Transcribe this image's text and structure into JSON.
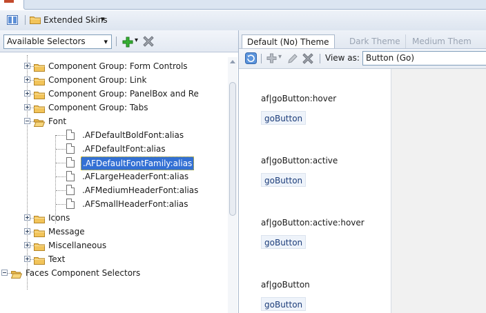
{
  "window": {
    "top_strip": ""
  },
  "main_toolbar": {
    "skin_menu_label": "Extended Skins",
    "skin_menu_arrow": "▾"
  },
  "left_panel": {
    "selector_dropdown_label": "Available Selectors",
    "selector_dropdown_arrow": "▾",
    "tree": [
      {
        "label": "Component Group: Form Controls",
        "type": "folder",
        "expanded": false
      },
      {
        "label": "Component Group: Link",
        "type": "folder",
        "expanded": false
      },
      {
        "label": "Component Group: PanelBox and Re",
        "type": "folder",
        "expanded": false
      },
      {
        "label": "Component Group: Tabs",
        "type": "folder",
        "expanded": false
      },
      {
        "label": "Font",
        "type": "folder",
        "expanded": true
      },
      {
        "label": ".AFDefaultBoldFont:alias",
        "type": "item"
      },
      {
        "label": ".AFDefaultFont:alias",
        "type": "item"
      },
      {
        "label": ".AFDefaultFontFamily:alias",
        "type": "item",
        "selected": true
      },
      {
        "label": ".AFLargeHeaderFont:alias",
        "type": "item"
      },
      {
        "label": ".AFMediumHeaderFont:alias",
        "type": "item"
      },
      {
        "label": ".AFSmallHeaderFont:alias",
        "type": "item"
      },
      {
        "label": "Icons",
        "type": "folder",
        "expanded": false
      },
      {
        "label": "Message",
        "type": "folder",
        "expanded": false
      },
      {
        "label": "Miscellaneous",
        "type": "folder",
        "expanded": false
      },
      {
        "label": "Text",
        "type": "folder",
        "expanded": false
      },
      {
        "label": "Faces Component Selectors",
        "type": "folder",
        "expanded": true
      }
    ]
  },
  "right_panel": {
    "tabs": [
      {
        "label": "Default (No) Theme",
        "active": true
      },
      {
        "label": "Dark Theme",
        "active": false
      },
      {
        "label": "Medium Them",
        "active": false
      }
    ],
    "view_as_label": "View as:",
    "view_as_value": "Button (Go)",
    "preview": [
      {
        "selector": "af|goButton:hover",
        "button": "goButton"
      },
      {
        "selector": "af|goButton:active",
        "button": "goButton"
      },
      {
        "selector": "af|goButton:active:hover",
        "button": "goButton"
      },
      {
        "selector": "af|goButton",
        "button": "goButton"
      }
    ]
  },
  "colors": {
    "selection": "#3370d4",
    "folder": "#e8b74a",
    "add_green": "#2fa12c",
    "delete_gray": "#8a8f98"
  },
  "icons": {
    "split_view": "split-view-icon",
    "folder": "folder-icon",
    "add": "add-icon",
    "delete": "delete-icon",
    "refresh": "refresh-icon",
    "edit": "edit-icon",
    "document": "document-icon"
  }
}
